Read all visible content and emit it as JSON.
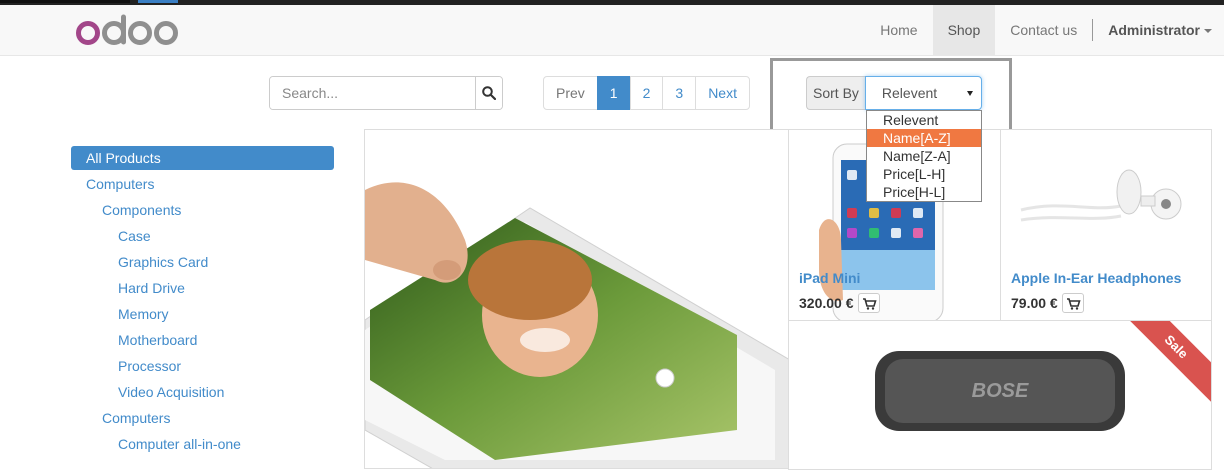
{
  "navbar": {
    "logo_text": "odoo",
    "items": [
      {
        "label": "Home",
        "active": false
      },
      {
        "label": "Shop",
        "active": true
      },
      {
        "label": "Contact us",
        "active": false
      }
    ],
    "user": "Administrator"
  },
  "search": {
    "placeholder": "Search...",
    "icon": "search-icon"
  },
  "pager": {
    "prev": "Prev",
    "pages": [
      "1",
      "2",
      "3"
    ],
    "current": "1",
    "next": "Next"
  },
  "sort": {
    "label": "Sort By",
    "selected": "Relevent",
    "options": [
      "Relevent",
      "Name[A-Z]",
      "Name[Z-A]",
      "Price[L-H]",
      "Price[H-L]"
    ],
    "highlighted": "Name[A-Z]"
  },
  "categories": [
    {
      "label": "All Products",
      "level": 0,
      "active": true
    },
    {
      "label": "Computers",
      "level": 1
    },
    {
      "label": "Components",
      "level": 2
    },
    {
      "label": "Case",
      "level": 3
    },
    {
      "label": "Graphics Card",
      "level": 3
    },
    {
      "label": "Hard Drive",
      "level": 3
    },
    {
      "label": "Memory",
      "level": 3
    },
    {
      "label": "Motherboard",
      "level": 3
    },
    {
      "label": "Processor",
      "level": 3
    },
    {
      "label": "Video Acquisition",
      "level": 3
    },
    {
      "label": "Computers",
      "level": 2
    },
    {
      "label": "Computer all-in-one",
      "level": 3
    }
  ],
  "products": [
    {
      "name": "iPad Mini",
      "price": "320.00 €"
    },
    {
      "name": "Apple In-Ear Headphones",
      "price": "79.00 €"
    },
    {
      "sale_ribbon": "Sale"
    }
  ],
  "colors": {
    "accent": "#428bca",
    "highlight": "#f07841",
    "sale": "#d9534f"
  }
}
